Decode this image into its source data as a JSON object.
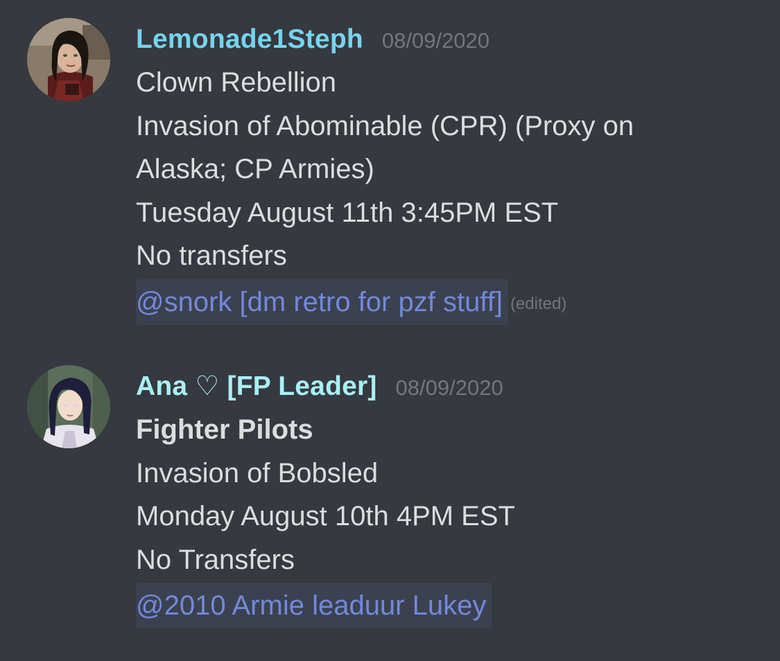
{
  "messages": [
    {
      "username": "Lemonade1Steph",
      "timestamp": "08/09/2020",
      "lines": [
        "Clown Rebellion",
        "Invasion of Abominable (CPR) (Proxy on",
        "Alaska; CP Armies)",
        "Tuesday August 11th 3:45PM EST",
        "No transfers"
      ],
      "mention": "@snork [dm retro for pzf stuff]",
      "edited_label": "(edited)",
      "username_color": "#74d4f1"
    },
    {
      "username": "Ana ♡ [FP Leader]",
      "timestamp": "08/09/2020",
      "title": "Fighter Pilots",
      "lines": [
        "Invasion of Bobsled",
        "Monday August 10th 4PM EST",
        "No Transfers"
      ],
      "mention": "@2010 Armie leaduur Lukey",
      "username_color": "#a8f0f6"
    }
  ],
  "colors": {
    "background": "#36393f",
    "text": "#dcddde",
    "timestamp": "#72767d",
    "mention_text": "#7289da",
    "mention_bg": "#3c4150"
  }
}
